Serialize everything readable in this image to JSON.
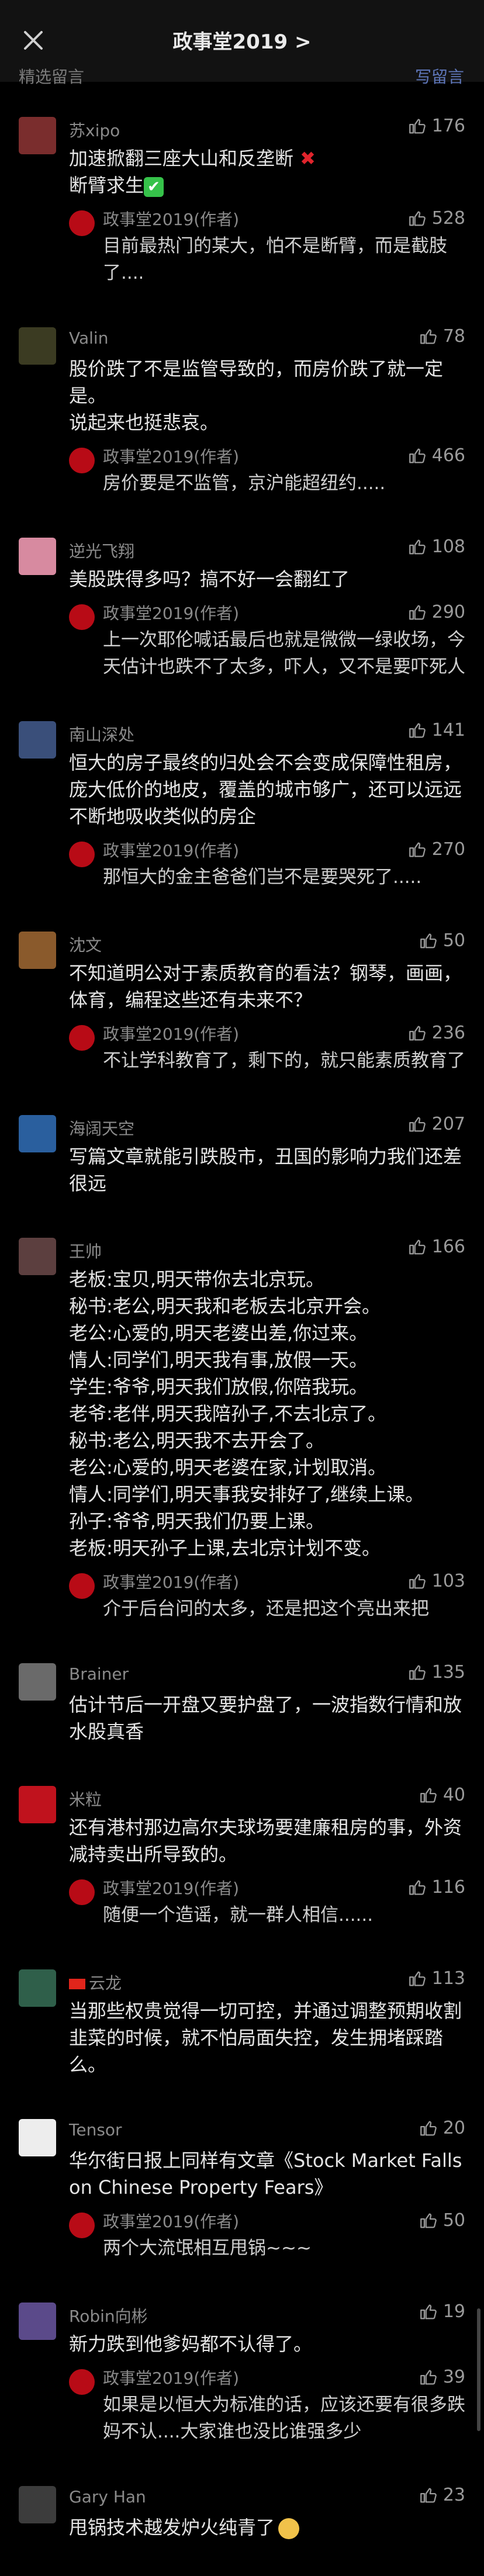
{
  "header": {
    "title": "政事堂2019 >",
    "featured_label": "精选留言",
    "write_label": "写留言"
  },
  "comments": [
    {
      "name": "苏xipo",
      "likes": "176",
      "lines": [
        "加速掀翻三座大山和反垄断",
        "断臂求生"
      ],
      "reply": {
        "name": "政事堂2019(作者)",
        "likes": "528",
        "text": "目前最热门的某大，怕不是断臂，而是截肢了...."
      }
    },
    {
      "name": "Valin",
      "likes": "78",
      "lines": [
        "股价跌了不是监管导致的，而房价跌了就一定是。",
        "说起来也挺悲哀。"
      ],
      "reply": {
        "name": "政事堂2019(作者)",
        "likes": "466",
        "text": "房价要是不监管，京沪能超纽约....."
      }
    },
    {
      "name": "逆光飞翔",
      "likes": "108",
      "lines": [
        "美股跌得多吗？搞不好一会翻红了"
      ],
      "reply": {
        "name": "政事堂2019(作者)",
        "likes": "290",
        "text": "上一次耶伦喊话最后也就是微微一绿收场，今天估计也跌不了太多，吓人，又不是要吓死人"
      }
    },
    {
      "name": "南山深处",
      "likes": "141",
      "lines": [
        "恒大的房子最终的归处会不会变成保障性租房，庞大低价的地皮，覆盖的城市够广，还可以远远不断地吸收类似的房企"
      ],
      "reply": {
        "name": "政事堂2019(作者)",
        "likes": "270",
        "text": "那恒大的金主爸爸们岂不是要哭死了....."
      }
    },
    {
      "name": "沈文",
      "likes": "50",
      "lines": [
        "不知道明公对于素质教育的看法？钢琴，画画，体育，编程这些还有未来不？"
      ],
      "reply": {
        "name": "政事堂2019(作者)",
        "likes": "236",
        "text": "不让学科教育了，剩下的，就只能素质教育了"
      }
    },
    {
      "name": "海阔天空",
      "likes": "207",
      "lines": [
        "写篇文章就能引跌股市，丑国的影响力我们还差很远"
      ],
      "reply": null
    },
    {
      "name": "王帅",
      "likes": "166",
      "lines": [
        "老板:宝贝,明天带你去北京玩。",
        "秘书:老公,明天我和老板去北京开会。",
        "老公:心爱的,明天老婆出差,你过来。",
        "情人:同学们,明天我有事,放假一天。",
        "学生:爷爷,明天我们放假,你陪我玩。",
        "老爷:老伴,明天我陪孙子,不去北京了。",
        "秘书:老公,明天我不去开会了。",
        "老公:心爱的,明天老婆在家,计划取消。",
        "情人:同学们,明天事我安排好了,继续上课。",
        "孙子:爷爷,明天我们仍要上课。",
        "老板:明天孙子上课,去北京计划不变。"
      ],
      "reply": {
        "name": "政事堂2019(作者)",
        "likes": "103",
        "text": "介于后台问的太多，还是把这个亮出来把"
      }
    },
    {
      "name": "Brainer",
      "likes": "135",
      "lines": [
        "估计节后一开盘又要护盘了，一波指数行情和放水股真香"
      ],
      "reply": null
    },
    {
      "name": "米粒",
      "likes": "40",
      "lines": [
        "还有港村那边高尔夫球场要建廉租房的事，外资减持卖出所导致的。"
      ],
      "reply": {
        "name": "政事堂2019(作者)",
        "likes": "116",
        "text": "随便一个造谣，就一群人相信......"
      }
    },
    {
      "name": "云龙",
      "likes": "113",
      "lines": [
        "当那些权贵觉得一切可控，并通过调整预期收割韭菜的时候，就不怕局面失控，发生拥堵踩踏么。"
      ],
      "reply": null
    },
    {
      "name": "Tensor",
      "likes": "20",
      "lines": [
        "华尔街日报上同样有文章《Stock Market Falls on Chinese Property Fears》"
      ],
      "reply": {
        "name": "政事堂2019(作者)",
        "likes": "50",
        "text": "两个大流氓相互甩锅~~~"
      }
    },
    {
      "name": "Robin向彬",
      "likes": "19",
      "lines": [
        "新力跌到他爹妈都不认得了。"
      ],
      "reply": {
        "name": "政事堂2019(作者)",
        "likes": "39",
        "text": "如果是以恒大为标准的话，应该还要有很多跌妈不认....大家谁也没比谁强多少"
      }
    },
    {
      "name": "Gary Han",
      "likes": "23",
      "lines": [
        "甩锅技术越发炉火纯青了"
      ],
      "reply": null
    }
  ],
  "colors": {
    "background": "#000000",
    "nav": "#121212",
    "accent_link": "#5e76b8",
    "author_badge": "#b80b16"
  }
}
